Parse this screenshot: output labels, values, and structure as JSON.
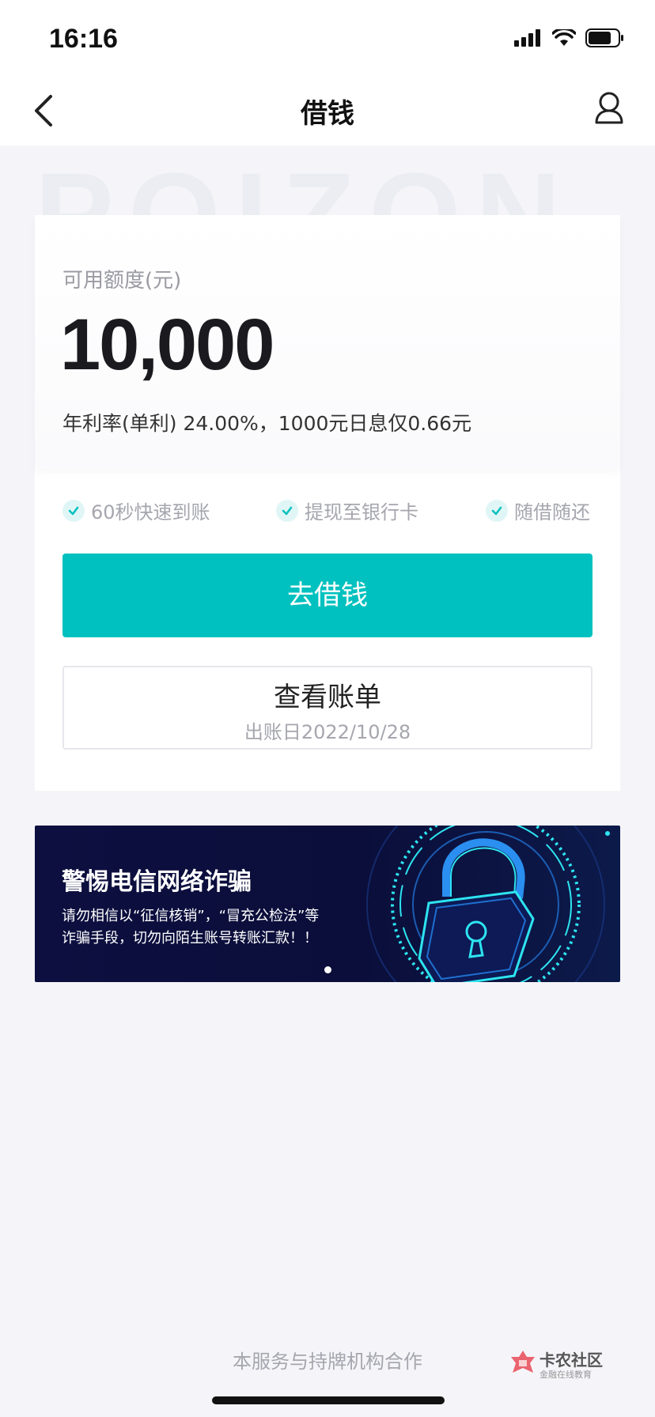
{
  "status_bar": {
    "time": "16:16"
  },
  "nav": {
    "title": "借钱"
  },
  "watermark": "POIZON",
  "quota": {
    "label": "可用额度(元)",
    "amount": "10,000",
    "rate_text": "年利率(单利) 24.00%，1000元日息仅0.66元"
  },
  "features": [
    {
      "label": "60秒快速到账"
    },
    {
      "label": "提现至银行卡"
    },
    {
      "label": "随借随还"
    }
  ],
  "buttons": {
    "borrow_label": "去借钱",
    "bill_label": "查看账单",
    "bill_date": "出账日2022/10/28"
  },
  "banner": {
    "title": "警惕电信网络诈骗",
    "line1": "请勿相信以“征信核销”，“冒充公检法”等",
    "line2": "诈骗手段，切勿向陌生账号转账汇款！！"
  },
  "footer": {
    "text": "本服务与持牌机构合作"
  },
  "brand": {
    "name": "卡农社区",
    "subtitle": "金融在线教育"
  },
  "colors": {
    "accent": "#00c1bf",
    "banner_bg": "#0d0f40",
    "neon": "#2de4f0"
  }
}
